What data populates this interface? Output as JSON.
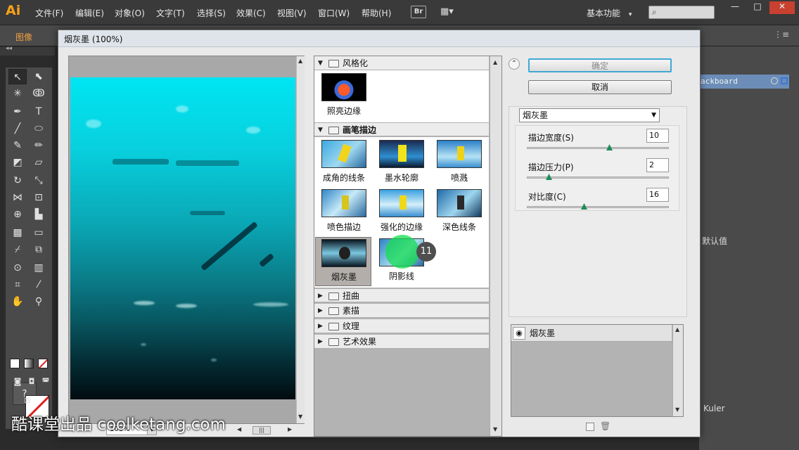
{
  "app": {
    "logo": "Ai",
    "menu": [
      "文件(F)",
      "编辑(E)",
      "对象(O)",
      "文字(T)",
      "选择(S)",
      "效果(C)",
      "视图(V)",
      "窗口(W)",
      "帮助(H)"
    ],
    "br_label": "Br",
    "workspace": "基本功能",
    "workspace_caret": "▾",
    "search_icon": "search-icon",
    "window_controls": [
      "—",
      "□",
      "✕"
    ]
  },
  "controlbar": {
    "label": "图像"
  },
  "right_panel": {
    "artboard": "ackboard",
    "reset": "默认值",
    "kuler": "Kuler"
  },
  "dialog": {
    "title": "烟灰墨 (100%)",
    "zoom": "100%",
    "ok": "确定",
    "cancel": "取消",
    "collapse_icon": "⌃",
    "selected_filter": "烟灰墨",
    "params": [
      {
        "label": "描边宽度(S)",
        "value": "10",
        "fraction": 0.58
      },
      {
        "label": "描边压力(P)",
        "value": "2",
        "fraction": 0.15
      },
      {
        "label": "对比度(C)",
        "value": "16",
        "fraction": 0.4
      }
    ],
    "layer_name": "烟灰墨",
    "browser": {
      "categories": [
        {
          "name": "风格化",
          "expanded": true,
          "bold": false,
          "items": [
            "照亮边缘"
          ]
        },
        {
          "name": "画笔描边",
          "expanded": true,
          "bold": true,
          "items": [
            "成角的线条",
            "墨水轮廓",
            "喷溅",
            "喷色描边",
            "强化的边缘",
            "深色线条",
            "烟灰墨",
            "阴影线"
          ]
        },
        {
          "name": "扭曲",
          "expanded": false,
          "bold": false,
          "items": []
        },
        {
          "name": "素描",
          "expanded": false,
          "bold": false,
          "items": []
        },
        {
          "name": "纹理",
          "expanded": false,
          "bold": false,
          "items": []
        },
        {
          "name": "艺术效果",
          "expanded": false,
          "bold": false,
          "items": []
        }
      ],
      "selected_item": "烟灰墨"
    }
  },
  "overlay": {
    "step_number": "11"
  },
  "watermark": "酷课堂出品 coolketang.com",
  "colors": {
    "ai_orange": "#f7a21b",
    "ok_border": "#3fa8d4",
    "slider": "#1d8d5a",
    "cursor_green": "#14dc50"
  }
}
